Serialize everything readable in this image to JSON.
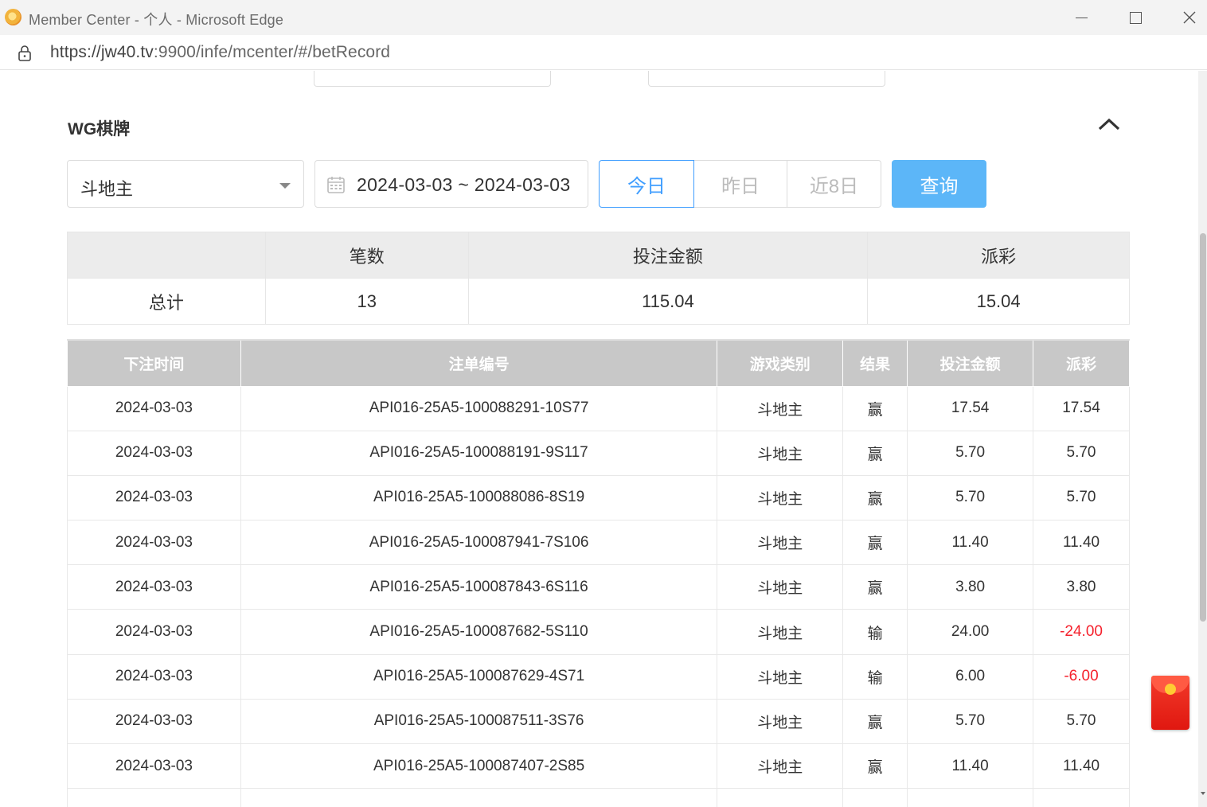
{
  "window": {
    "title": "Member Center - 个人 - Microsoft Edge",
    "url_host": "https://jw40.tv",
    "url_path": ":9900/infe/mcenter/#/betRecord"
  },
  "section": {
    "title": "WG棋牌"
  },
  "filters": {
    "game_select": "斗地主",
    "date_range": "2024-03-03 ~ 2024-03-03",
    "quick": [
      "今日",
      "昨日",
      "近8日"
    ],
    "query_label": "查询"
  },
  "summary": {
    "headers": [
      "",
      "笔数",
      "投注金额",
      "派彩"
    ],
    "row": [
      "总计",
      "13",
      "115.04",
      "15.04"
    ]
  },
  "records": {
    "headers": [
      "下注时间",
      "注单编号",
      "游戏类别",
      "结果",
      "投注金额",
      "派彩"
    ],
    "rows": [
      [
        "2024-03-03",
        "API016-25A5-100088291-10S77",
        "斗地主",
        "赢",
        "17.54",
        "17.54"
      ],
      [
        "2024-03-03",
        "API016-25A5-100088191-9S117",
        "斗地主",
        "赢",
        "5.70",
        "5.70"
      ],
      [
        "2024-03-03",
        "API016-25A5-100088086-8S19",
        "斗地主",
        "赢",
        "5.70",
        "5.70"
      ],
      [
        "2024-03-03",
        "API016-25A5-100087941-7S106",
        "斗地主",
        "赢",
        "11.40",
        "11.40"
      ],
      [
        "2024-03-03",
        "API016-25A5-100087843-6S116",
        "斗地主",
        "赢",
        "3.80",
        "3.80"
      ],
      [
        "2024-03-03",
        "API016-25A5-100087682-5S110",
        "斗地主",
        "输",
        "24.00",
        "-24.00"
      ],
      [
        "2024-03-03",
        "API016-25A5-100087629-4S71",
        "斗地主",
        "输",
        "6.00",
        "-6.00"
      ],
      [
        "2024-03-03",
        "API016-25A5-100087511-3S76",
        "斗地主",
        "赢",
        "5.70",
        "5.70"
      ],
      [
        "2024-03-03",
        "API016-25A5-100087407-2S85",
        "斗地主",
        "赢",
        "11.40",
        "11.40"
      ],
      [
        "",
        "",
        "",
        "",
        "",
        ""
      ]
    ]
  },
  "colors": {
    "accent": "#409eff",
    "query_button": "#5cb6f8",
    "negative": "#f5222d"
  }
}
